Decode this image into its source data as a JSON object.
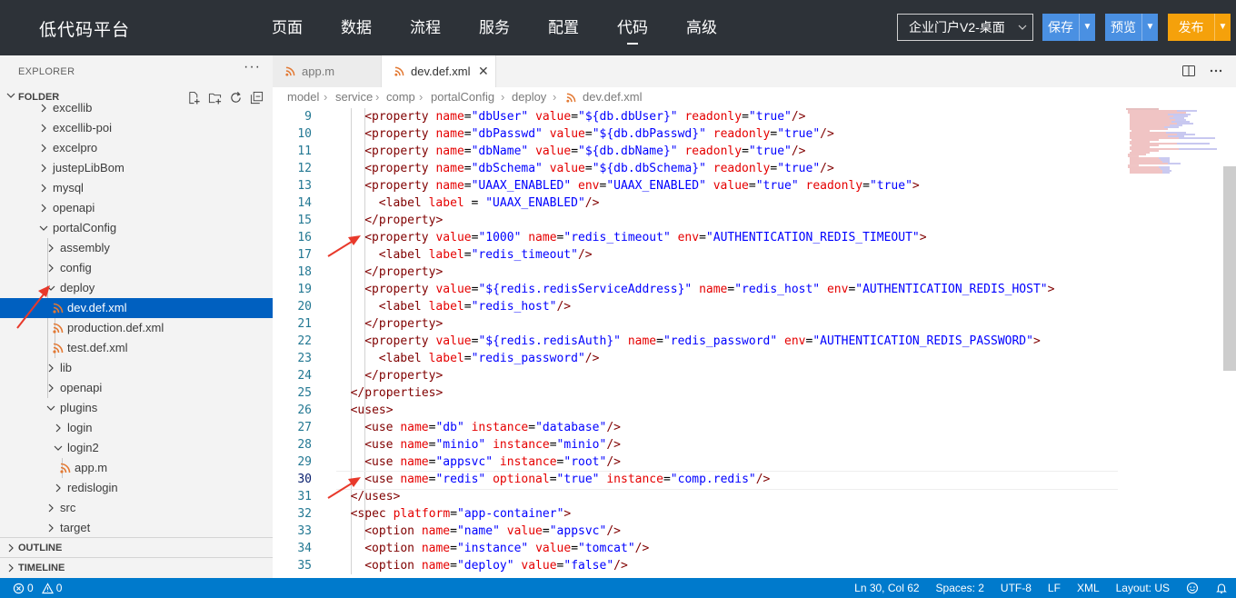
{
  "header": {
    "brand": "低代码平台",
    "nav": [
      "页面",
      "数据",
      "流程",
      "服务",
      "配置",
      "代码",
      "高级"
    ],
    "active_nav": "代码",
    "project_selector": "企业门户V2-桌面",
    "save_label": "保存",
    "preview_label": "预览",
    "publish_label": "发布"
  },
  "sidebar": {
    "explorer_title": "EXPLORER",
    "folder_label": "FOLDER",
    "tree": [
      {
        "label": "excellib",
        "depth": 1,
        "kind": "folder",
        "expanded": false
      },
      {
        "label": "excellib-poi",
        "depth": 1,
        "kind": "folder",
        "expanded": false
      },
      {
        "label": "excelpro",
        "depth": 1,
        "kind": "folder",
        "expanded": false
      },
      {
        "label": "justepLibBom",
        "depth": 1,
        "kind": "folder",
        "expanded": false
      },
      {
        "label": "mysql",
        "depth": 1,
        "kind": "folder",
        "expanded": false
      },
      {
        "label": "openapi",
        "depth": 1,
        "kind": "folder",
        "expanded": false
      },
      {
        "label": "portalConfig",
        "depth": 1,
        "kind": "folder",
        "expanded": true
      },
      {
        "label": "assembly",
        "depth": 2,
        "kind": "folder",
        "expanded": false
      },
      {
        "label": "config",
        "depth": 2,
        "kind": "folder",
        "expanded": false
      },
      {
        "label": "deploy",
        "depth": 2,
        "kind": "folder",
        "expanded": true
      },
      {
        "label": "dev.def.xml",
        "depth": 3,
        "kind": "file",
        "selected": true
      },
      {
        "label": "production.def.xml",
        "depth": 3,
        "kind": "file"
      },
      {
        "label": "test.def.xml",
        "depth": 3,
        "kind": "file"
      },
      {
        "label": "lib",
        "depth": 2,
        "kind": "folder",
        "expanded": false
      },
      {
        "label": "openapi",
        "depth": 2,
        "kind": "folder",
        "expanded": false
      },
      {
        "label": "plugins",
        "depth": 2,
        "kind": "folder",
        "expanded": true
      },
      {
        "label": "login",
        "depth": 3,
        "kind": "folder",
        "expanded": false
      },
      {
        "label": "login2",
        "depth": 3,
        "kind": "folder",
        "expanded": true
      },
      {
        "label": "app.m",
        "depth": 4,
        "kind": "file"
      },
      {
        "label": "redislogin",
        "depth": 3,
        "kind": "folder",
        "expanded": false
      },
      {
        "label": "src",
        "depth": 2,
        "kind": "folder",
        "expanded": false
      },
      {
        "label": "target",
        "depth": 2,
        "kind": "folder",
        "expanded": false
      }
    ],
    "outline_label": "OUTLINE",
    "timeline_label": "TIMELINE"
  },
  "editor": {
    "tabs": [
      {
        "label": "app.m",
        "active": false
      },
      {
        "label": "dev.def.xml",
        "active": true
      }
    ],
    "breadcrumb": [
      "model",
      "service",
      "comp",
      "portalConfig",
      "deploy",
      "dev.def.xml"
    ],
    "current_line": 30,
    "lines": [
      {
        "n": "9",
        "indent": 2,
        "tokens": [
          [
            "t",
            "<property "
          ],
          [
            "a",
            "name"
          ],
          [
            "p",
            "="
          ],
          [
            "s",
            "\"dbUser\""
          ],
          [
            "p",
            " "
          ],
          [
            "a",
            "value"
          ],
          [
            "p",
            "="
          ],
          [
            "s",
            "\"${db.dbUser}\""
          ],
          [
            "p",
            " "
          ],
          [
            "a",
            "readonly"
          ],
          [
            "p",
            "="
          ],
          [
            "s",
            "\"true\""
          ],
          [
            "t",
            "/>"
          ]
        ]
      },
      {
        "n": "10",
        "indent": 2,
        "tokens": [
          [
            "t",
            "<property "
          ],
          [
            "a",
            "name"
          ],
          [
            "p",
            "="
          ],
          [
            "s",
            "\"dbPasswd\""
          ],
          [
            "p",
            " "
          ],
          [
            "a",
            "value"
          ],
          [
            "p",
            "="
          ],
          [
            "s",
            "\"${db.dbPasswd}\""
          ],
          [
            "p",
            " "
          ],
          [
            "a",
            "readonly"
          ],
          [
            "p",
            "="
          ],
          [
            "s",
            "\"true\""
          ],
          [
            "t",
            "/>"
          ]
        ]
      },
      {
        "n": "11",
        "indent": 2,
        "tokens": [
          [
            "t",
            "<property "
          ],
          [
            "a",
            "name"
          ],
          [
            "p",
            "="
          ],
          [
            "s",
            "\"dbName\""
          ],
          [
            "p",
            " "
          ],
          [
            "a",
            "value"
          ],
          [
            "p",
            "="
          ],
          [
            "s",
            "\"${db.dbName}\""
          ],
          [
            "p",
            " "
          ],
          [
            "a",
            "readonly"
          ],
          [
            "p",
            "="
          ],
          [
            "s",
            "\"true\""
          ],
          [
            "t",
            "/>"
          ]
        ]
      },
      {
        "n": "12",
        "indent": 2,
        "tokens": [
          [
            "t",
            "<property "
          ],
          [
            "a",
            "name"
          ],
          [
            "p",
            "="
          ],
          [
            "s",
            "\"dbSchema\""
          ],
          [
            "p",
            " "
          ],
          [
            "a",
            "value"
          ],
          [
            "p",
            "="
          ],
          [
            "s",
            "\"${db.dbSchema}\""
          ],
          [
            "p",
            " "
          ],
          [
            "a",
            "readonly"
          ],
          [
            "p",
            "="
          ],
          [
            "s",
            "\"true\""
          ],
          [
            "t",
            "/>"
          ]
        ]
      },
      {
        "n": "13",
        "indent": 2,
        "tokens": [
          [
            "t",
            "<property "
          ],
          [
            "a",
            "name"
          ],
          [
            "p",
            "="
          ],
          [
            "s",
            "\"UAAX_ENABLED\""
          ],
          [
            "p",
            " "
          ],
          [
            "a",
            "env"
          ],
          [
            "p",
            "="
          ],
          [
            "s",
            "\"UAAX_ENABLED\""
          ],
          [
            "p",
            " "
          ],
          [
            "a",
            "value"
          ],
          [
            "p",
            "="
          ],
          [
            "s",
            "\"true\""
          ],
          [
            "p",
            " "
          ],
          [
            "a",
            "readonly"
          ],
          [
            "p",
            "="
          ],
          [
            "s",
            "\"true\""
          ],
          [
            "t",
            ">"
          ]
        ]
      },
      {
        "n": "14",
        "indent": 3,
        "tokens": [
          [
            "t",
            "<label "
          ],
          [
            "a",
            "label"
          ],
          [
            "p",
            " = "
          ],
          [
            "s",
            "\"UAAX_ENABLED\""
          ],
          [
            "t",
            "/>"
          ]
        ]
      },
      {
        "n": "15",
        "indent": 2,
        "tokens": [
          [
            "t",
            "</property>"
          ]
        ]
      },
      {
        "n": "16",
        "indent": 2,
        "tokens": [
          [
            "t",
            "<property "
          ],
          [
            "a",
            "value"
          ],
          [
            "p",
            "="
          ],
          [
            "s",
            "\"1000\""
          ],
          [
            "p",
            " "
          ],
          [
            "a",
            "name"
          ],
          [
            "p",
            "="
          ],
          [
            "s",
            "\"redis_timeout\""
          ],
          [
            "p",
            " "
          ],
          [
            "a",
            "env"
          ],
          [
            "p",
            "="
          ],
          [
            "s",
            "\"AUTHENTICATION_REDIS_TIMEOUT\""
          ],
          [
            "t",
            ">"
          ]
        ]
      },
      {
        "n": "17",
        "indent": 3,
        "tokens": [
          [
            "t",
            "<label "
          ],
          [
            "a",
            "label"
          ],
          [
            "p",
            "="
          ],
          [
            "s",
            "\"redis_timeout\""
          ],
          [
            "t",
            "/>"
          ]
        ]
      },
      {
        "n": "18",
        "indent": 2,
        "tokens": [
          [
            "t",
            "</property>"
          ]
        ]
      },
      {
        "n": "19",
        "indent": 2,
        "tokens": [
          [
            "t",
            "<property "
          ],
          [
            "a",
            "value"
          ],
          [
            "p",
            "="
          ],
          [
            "s",
            "\"${redis.redisServiceAddress}\""
          ],
          [
            "p",
            " "
          ],
          [
            "a",
            "name"
          ],
          [
            "p",
            "="
          ],
          [
            "s",
            "\"redis_host\""
          ],
          [
            "p",
            " "
          ],
          [
            "a",
            "env"
          ],
          [
            "p",
            "="
          ],
          [
            "s",
            "\"AUTHENTICATION_REDIS_HOST\""
          ],
          [
            "t",
            ">"
          ]
        ]
      },
      {
        "n": "20",
        "indent": 3,
        "tokens": [
          [
            "t",
            "<label "
          ],
          [
            "a",
            "label"
          ],
          [
            "p",
            "="
          ],
          [
            "s",
            "\"redis_host\""
          ],
          [
            "t",
            "/>"
          ]
        ]
      },
      {
        "n": "21",
        "indent": 2,
        "tokens": [
          [
            "t",
            "</property>"
          ]
        ]
      },
      {
        "n": "22",
        "indent": 2,
        "tokens": [
          [
            "t",
            "<property "
          ],
          [
            "a",
            "value"
          ],
          [
            "p",
            "="
          ],
          [
            "s",
            "\"${redis.redisAuth}\""
          ],
          [
            "p",
            " "
          ],
          [
            "a",
            "name"
          ],
          [
            "p",
            "="
          ],
          [
            "s",
            "\"redis_password\""
          ],
          [
            "p",
            " "
          ],
          [
            "a",
            "env"
          ],
          [
            "p",
            "="
          ],
          [
            "s",
            "\"AUTHENTICATION_REDIS_PASSWORD\""
          ],
          [
            "t",
            ">"
          ]
        ]
      },
      {
        "n": "23",
        "indent": 3,
        "tokens": [
          [
            "t",
            "<label "
          ],
          [
            "a",
            "label"
          ],
          [
            "p",
            "="
          ],
          [
            "s",
            "\"redis_password\""
          ],
          [
            "t",
            "/>"
          ]
        ]
      },
      {
        "n": "24",
        "indent": 2,
        "tokens": [
          [
            "t",
            "</property>"
          ]
        ]
      },
      {
        "n": "25",
        "indent": 1,
        "tokens": [
          [
            "t",
            "</properties>"
          ]
        ]
      },
      {
        "n": "26",
        "indent": 1,
        "tokens": [
          [
            "t",
            "<uses>"
          ]
        ]
      },
      {
        "n": "27",
        "indent": 2,
        "tokens": [
          [
            "t",
            "<use "
          ],
          [
            "a",
            "name"
          ],
          [
            "p",
            "="
          ],
          [
            "s",
            "\"db\""
          ],
          [
            "p",
            " "
          ],
          [
            "a",
            "instance"
          ],
          [
            "p",
            "="
          ],
          [
            "s",
            "\"database\""
          ],
          [
            "t",
            "/>"
          ]
        ]
      },
      {
        "n": "28",
        "indent": 2,
        "tokens": [
          [
            "t",
            "<use "
          ],
          [
            "a",
            "name"
          ],
          [
            "p",
            "="
          ],
          [
            "s",
            "\"minio\""
          ],
          [
            "p",
            " "
          ],
          [
            "a",
            "instance"
          ],
          [
            "p",
            "="
          ],
          [
            "s",
            "\"minio\""
          ],
          [
            "t",
            "/>"
          ]
        ]
      },
      {
        "n": "29",
        "indent": 2,
        "tokens": [
          [
            "t",
            "<use "
          ],
          [
            "a",
            "name"
          ],
          [
            "p",
            "="
          ],
          [
            "s",
            "\"appsvc\""
          ],
          [
            "p",
            " "
          ],
          [
            "a",
            "instance"
          ],
          [
            "p",
            "="
          ],
          [
            "s",
            "\"root\""
          ],
          [
            "t",
            "/>"
          ]
        ]
      },
      {
        "n": "30",
        "indent": 2,
        "tokens": [
          [
            "t",
            "<use "
          ],
          [
            "a",
            "name"
          ],
          [
            "p",
            "="
          ],
          [
            "s",
            "\"redis\""
          ],
          [
            "p",
            " "
          ],
          [
            "a",
            "optional"
          ],
          [
            "p",
            "="
          ],
          [
            "s",
            "\"true\""
          ],
          [
            "p",
            " "
          ],
          [
            "a",
            "instance"
          ],
          [
            "p",
            "="
          ],
          [
            "s",
            "\"comp.redis\""
          ],
          [
            "t",
            "/>"
          ]
        ]
      },
      {
        "n": "31",
        "indent": 1,
        "tokens": [
          [
            "t",
            "</uses>"
          ]
        ]
      },
      {
        "n": "32",
        "indent": 1,
        "tokens": [
          [
            "t",
            "<spec "
          ],
          [
            "a",
            "platform"
          ],
          [
            "p",
            "="
          ],
          [
            "s",
            "\"app-container\""
          ],
          [
            "t",
            ">"
          ]
        ]
      },
      {
        "n": "33",
        "indent": 2,
        "tokens": [
          [
            "t",
            "<option "
          ],
          [
            "a",
            "name"
          ],
          [
            "p",
            "="
          ],
          [
            "s",
            "\"name\""
          ],
          [
            "p",
            " "
          ],
          [
            "a",
            "value"
          ],
          [
            "p",
            "="
          ],
          [
            "s",
            "\"appsvc\""
          ],
          [
            "t",
            "/>"
          ]
        ]
      },
      {
        "n": "34",
        "indent": 2,
        "tokens": [
          [
            "t",
            "<option "
          ],
          [
            "a",
            "name"
          ],
          [
            "p",
            "="
          ],
          [
            "s",
            "\"instance\""
          ],
          [
            "p",
            " "
          ],
          [
            "a",
            "value"
          ],
          [
            "p",
            "="
          ],
          [
            "s",
            "\"tomcat\""
          ],
          [
            "t",
            "/>"
          ]
        ]
      },
      {
        "n": "35",
        "indent": 2,
        "tokens": [
          [
            "t",
            "<option "
          ],
          [
            "a",
            "name"
          ],
          [
            "p",
            "="
          ],
          [
            "s",
            "\"deploy\""
          ],
          [
            "p",
            " "
          ],
          [
            "a",
            "value"
          ],
          [
            "p",
            "="
          ],
          [
            "s",
            "\"false\""
          ],
          [
            "t",
            "/>"
          ]
        ]
      }
    ]
  },
  "statusbar": {
    "errors": "0",
    "warnings": "0",
    "cursor": "Ln 30, Col 62",
    "spaces": "Spaces: 2",
    "encoding": "UTF-8",
    "eol": "LF",
    "language": "XML",
    "layout": "Layout: US"
  },
  "colors": {
    "topbar_bg": "#2d3238",
    "primary_button": "#4a90e2",
    "publish_button": "#f5a10b",
    "selection": "#0060c0",
    "statusbar_bg": "#007acc",
    "xml_tag": "#800000",
    "xml_attr": "#e50000",
    "xml_string": "#0000ff",
    "annotation_arrow": "#e8392b"
  },
  "icons": {
    "file_type": "rss-icon",
    "folder_actions": [
      "new-file-icon",
      "new-folder-icon",
      "refresh-icon",
      "collapse-all-icon"
    ],
    "editor_actions": [
      "split-editor-icon",
      "more-actions-icon"
    ]
  }
}
